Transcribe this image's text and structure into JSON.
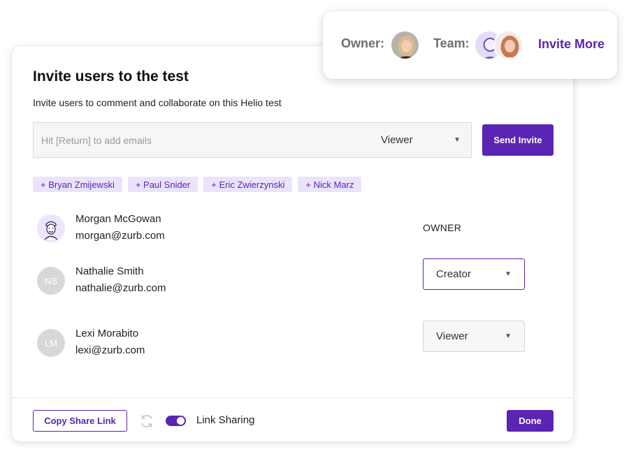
{
  "modal": {
    "title": "Invite users to the test",
    "subtitle": "Invite users to comment and collaborate on this Helio test",
    "invite_input": {
      "placeholder": "Hit [Return] to add emails",
      "value": ""
    },
    "invite_role": "Viewer",
    "send_invite_label": "Send Invite",
    "suggestions": [
      "+ Bryan Zmijewski",
      "+ Paul Snider",
      "+ Eric Zwierzynski",
      "+ Nick Marz"
    ],
    "users": [
      {
        "name": "Morgan McGowan",
        "email": "morgan@zurb.com",
        "role": "OWNER",
        "avatar": "illustration-avatar-icon"
      },
      {
        "name": "Nathalie Smith",
        "email": "nathalie@zurb.com",
        "role": "Creator",
        "initials": "NS"
      },
      {
        "name": "Lexi Morabito",
        "email": "lexi@zurb.com",
        "role": "Viewer",
        "initials": "LM"
      }
    ],
    "footer": {
      "copy_link_label": "Copy Share Link",
      "link_sharing_label": "Link Sharing",
      "link_sharing_enabled": true,
      "done_label": "Done"
    }
  },
  "team_card": {
    "owner_label": "Owner:",
    "team_label": "Team:",
    "invite_more_label": "Invite More"
  },
  "colors": {
    "accent": "#5a24b4",
    "chip_bg": "#ebe3fb",
    "avatar_gray": "#d8d8d8"
  }
}
